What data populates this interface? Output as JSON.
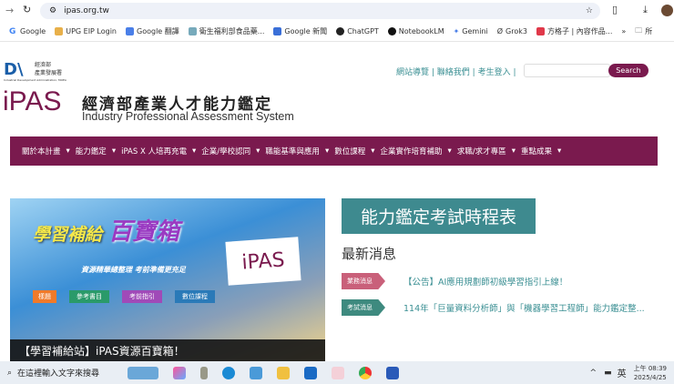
{
  "browser": {
    "url": "ipas.org.tw",
    "bookmarks": [
      "Google",
      "UPG EIP Login",
      "Google 翻譯",
      "衛生福利部食品藥...",
      "Google 新聞",
      "ChatGPT",
      "NotebookLM",
      "Gemini",
      "Grok3",
      "方格子 | 內容作品...",
      "所"
    ],
    "more": "»"
  },
  "header": {
    "org_name_line1": "經濟部",
    "org_name_line2": "產業發展署",
    "org_en": "Industrial Development Administration, MOEA",
    "logo": "iPAS",
    "title_zh": "經濟部產業人才能力鑑定",
    "title_en": "Industry Professional Assessment System",
    "links": [
      "網站導覽",
      "聯絡我們",
      "考生登入"
    ],
    "search_placeholder": "",
    "search_button": "Search"
  },
  "nav": [
    "關於本計畫",
    "能力鑑定",
    "iPAS X 人培再充電",
    "企業/學校認同",
    "職能基準與應用",
    "數位課程",
    "企業實作培育補助",
    "求職/求才專區",
    "重點成果"
  ],
  "banner": {
    "title1": "學習補給",
    "title2": "百寶箱",
    "subtitle": "資源精華總整理 考前準備更充足",
    "chips": [
      "樣題",
      "參考書目",
      "考前指引",
      "數位課程"
    ],
    "caption": "【學習補給站】iPAS資源百寶箱！"
  },
  "main": {
    "timetable_button": "能力鑑定考試時程表",
    "news_heading": "最新消息",
    "news": [
      {
        "tag": "業務消息",
        "text": "【公告】AI應用規劃師初級學習指引上線！",
        "color": "#c9607a"
      },
      {
        "tag": "考試消息",
        "text": "114年「巨量資料分析師」與「機器學習工程師」能力鑑定整...",
        "color": "#3e8a7f"
      }
    ]
  },
  "taskbar": {
    "search_placeholder": "在這裡輸入文字來搜尋",
    "ime": "英",
    "time": "上午 08:39",
    "date": "2025/4/25"
  }
}
